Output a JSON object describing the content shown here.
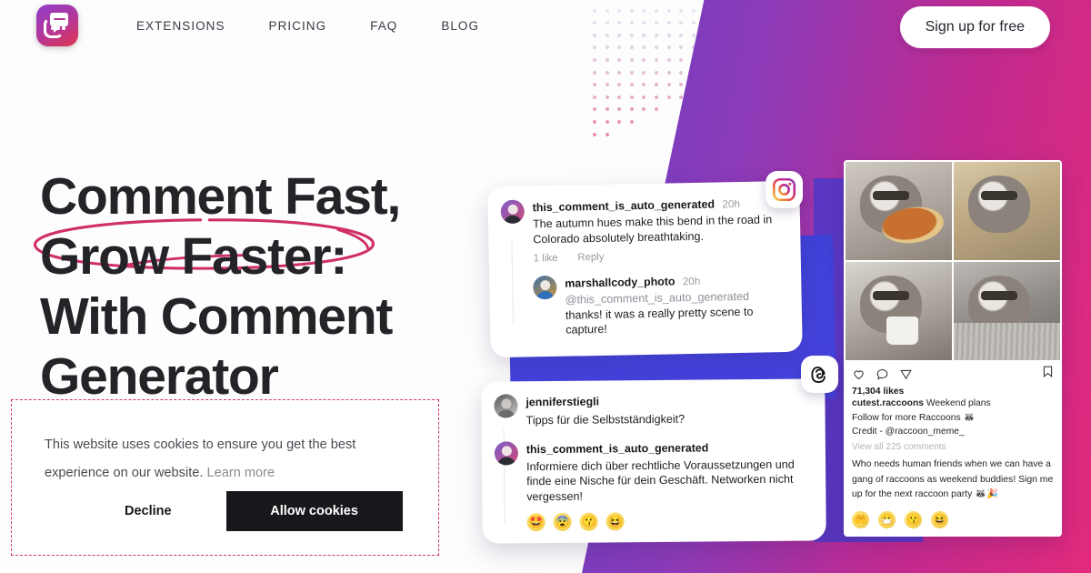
{
  "brand": {
    "logo_icon": "comment-bubble-logo-icon",
    "accent_purple": "#6b3fc4",
    "accent_magenta": "#e22a7c",
    "accent_blue": "#3f42d8",
    "highlight_pink": "#d1356f"
  },
  "header": {
    "nav_items": [
      {
        "label": "EXTENSIONS"
      },
      {
        "label": "PRICING"
      },
      {
        "label": "FAQ"
      },
      {
        "label": "BLOG"
      }
    ],
    "signup_label": "Sign up for free"
  },
  "hero": {
    "heading_lines": [
      "Comment Fast,",
      "Grow Faster:",
      "With Comment",
      "Generator"
    ],
    "circled_line_index": 1
  },
  "cookie_banner": {
    "message": "This website uses cookies to ensure you get the best experience on our website.",
    "learn_more_label": "Learn more",
    "decline_label": "Decline",
    "allow_label": "Allow cookies"
  },
  "instagram_card": {
    "platform_badge_icon": "instagram-icon",
    "comments": [
      {
        "username": "this_comment_is_auto_generated",
        "time": "20h",
        "text": "The autumn hues make this bend in the road in Colorado absolutely breathtaking.",
        "likes_label": "1 like",
        "reply_label": "Reply"
      },
      {
        "username": "marshallcody_photo",
        "time": "20h",
        "mention": "@this_comment_is_auto_generated",
        "text": "thanks! it was a really pretty scene to capture!"
      }
    ]
  },
  "threads_card": {
    "platform_badge_icon": "threads-icon",
    "comments": [
      {
        "username": "jenniferstiegli",
        "text": "Tipps für die Selbstständigkeit?"
      },
      {
        "username": "this_comment_is_auto_generated",
        "text": "Informiere dich über rechtliche Voraussetzungen und finde eine Nische für dein Geschäft. Networken nicht vergessen!"
      }
    ],
    "reactions": [
      "🤩",
      "😨",
      "😗",
      "😆"
    ]
  },
  "instagram_post": {
    "photos": [
      {
        "alt": "raccoon-with-pizza"
      },
      {
        "alt": "raccoon-on-wicker-chair"
      },
      {
        "alt": "raccoon-holding-mug"
      },
      {
        "alt": "raccoon-under-blanket"
      }
    ],
    "actions": [
      {
        "icon": "heart-icon"
      },
      {
        "icon": "comment-icon"
      },
      {
        "icon": "share-icon"
      },
      {
        "icon": "bookmark-icon"
      }
    ],
    "likes": "71,304 likes",
    "caption_author": "cutest.raccoons",
    "caption_title": "Weekend plans",
    "caption_line2": "Follow for more Raccoons 🦝",
    "caption_line3": "Credit - @raccoon_meme_",
    "view_all_label": "View all 225 comments",
    "top_comment": "Who needs human friends when we can have a gang of raccoons as weekend buddies! Sign me up for the next raccoon party 🦝🎉",
    "reactions": [
      "🤲",
      "😷",
      "😗",
      "😆"
    ]
  }
}
